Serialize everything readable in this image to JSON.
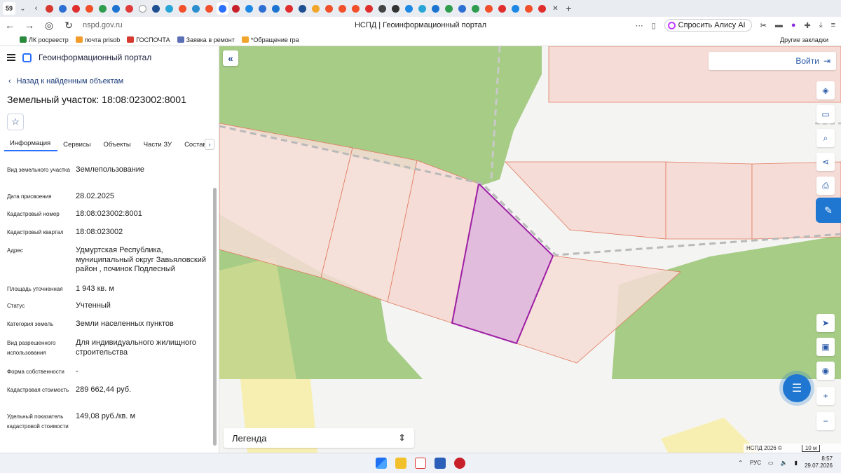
{
  "browser": {
    "tab_count": "59",
    "url": "nspd.gov.ru",
    "page_title": "НСПД | Геоинформационный портал",
    "alice_label": "Спросить Алису AI",
    "bookmarks": [
      "ЛК росреестр",
      "почта prisob",
      "ГОСПОЧТА",
      "Заявка в ремонт",
      "*Обращение гра"
    ],
    "other_bookmarks": "Другие закладки"
  },
  "sidebar": {
    "portal_title": "Геоинформационный портал",
    "back_link": "Назад к найденным объектам",
    "parcel_title": "Земельный участок: 18:08:023002:8001",
    "tabs": [
      "Информация",
      "Сервисы",
      "Объекты",
      "Части ЗУ",
      "Состав"
    ],
    "properties": [
      {
        "label": "Вид земельного участка",
        "value": "Землепользование"
      },
      {
        "label": "Дата присвоения",
        "value": "28.02.2025"
      },
      {
        "label": "Кадастровый номер",
        "value": "18:08:023002:8001"
      },
      {
        "label": "Кадастровый квартал",
        "value": "18:08:023002"
      },
      {
        "label": "Адрес",
        "value": "Удмуртская Республика, муниципальный округ Завьяловский район , починок Подлесный"
      },
      {
        "label": "Площадь уточненная",
        "value": "1 943 кв. м"
      },
      {
        "label": "Статус",
        "value": "Учтенный"
      },
      {
        "label": "Категория земель",
        "value": "Земли населенных пунктов"
      },
      {
        "label": "Вид разрешенного использования",
        "value": "Для индивидуального жилищного строительства"
      },
      {
        "label": "Форма собственности",
        "value": "-"
      },
      {
        "label": "Кадастровая стоимость",
        "value": "289 662,44 руб."
      },
      {
        "label": "Удельный показатель кадастровой стоимости",
        "value": "149,08 руб./кв. м"
      }
    ]
  },
  "map": {
    "login_label": "Войти",
    "legend_label": "Легенда",
    "attribution": "НСПД 2026 ©",
    "scale_label": "10 м",
    "colors": {
      "forest": "#9ec87f",
      "parcel_fill": "#f6dcd6",
      "parcel_line": "#e07a5f",
      "selected_fill": "#e2bcdc",
      "selected_line": "#9d1fa5",
      "road": "#f5f4f2",
      "accent": "#1f77d1"
    }
  },
  "taskbar": {
    "lang": "РУС",
    "time": "8:57",
    "date": "29.07.2026"
  }
}
